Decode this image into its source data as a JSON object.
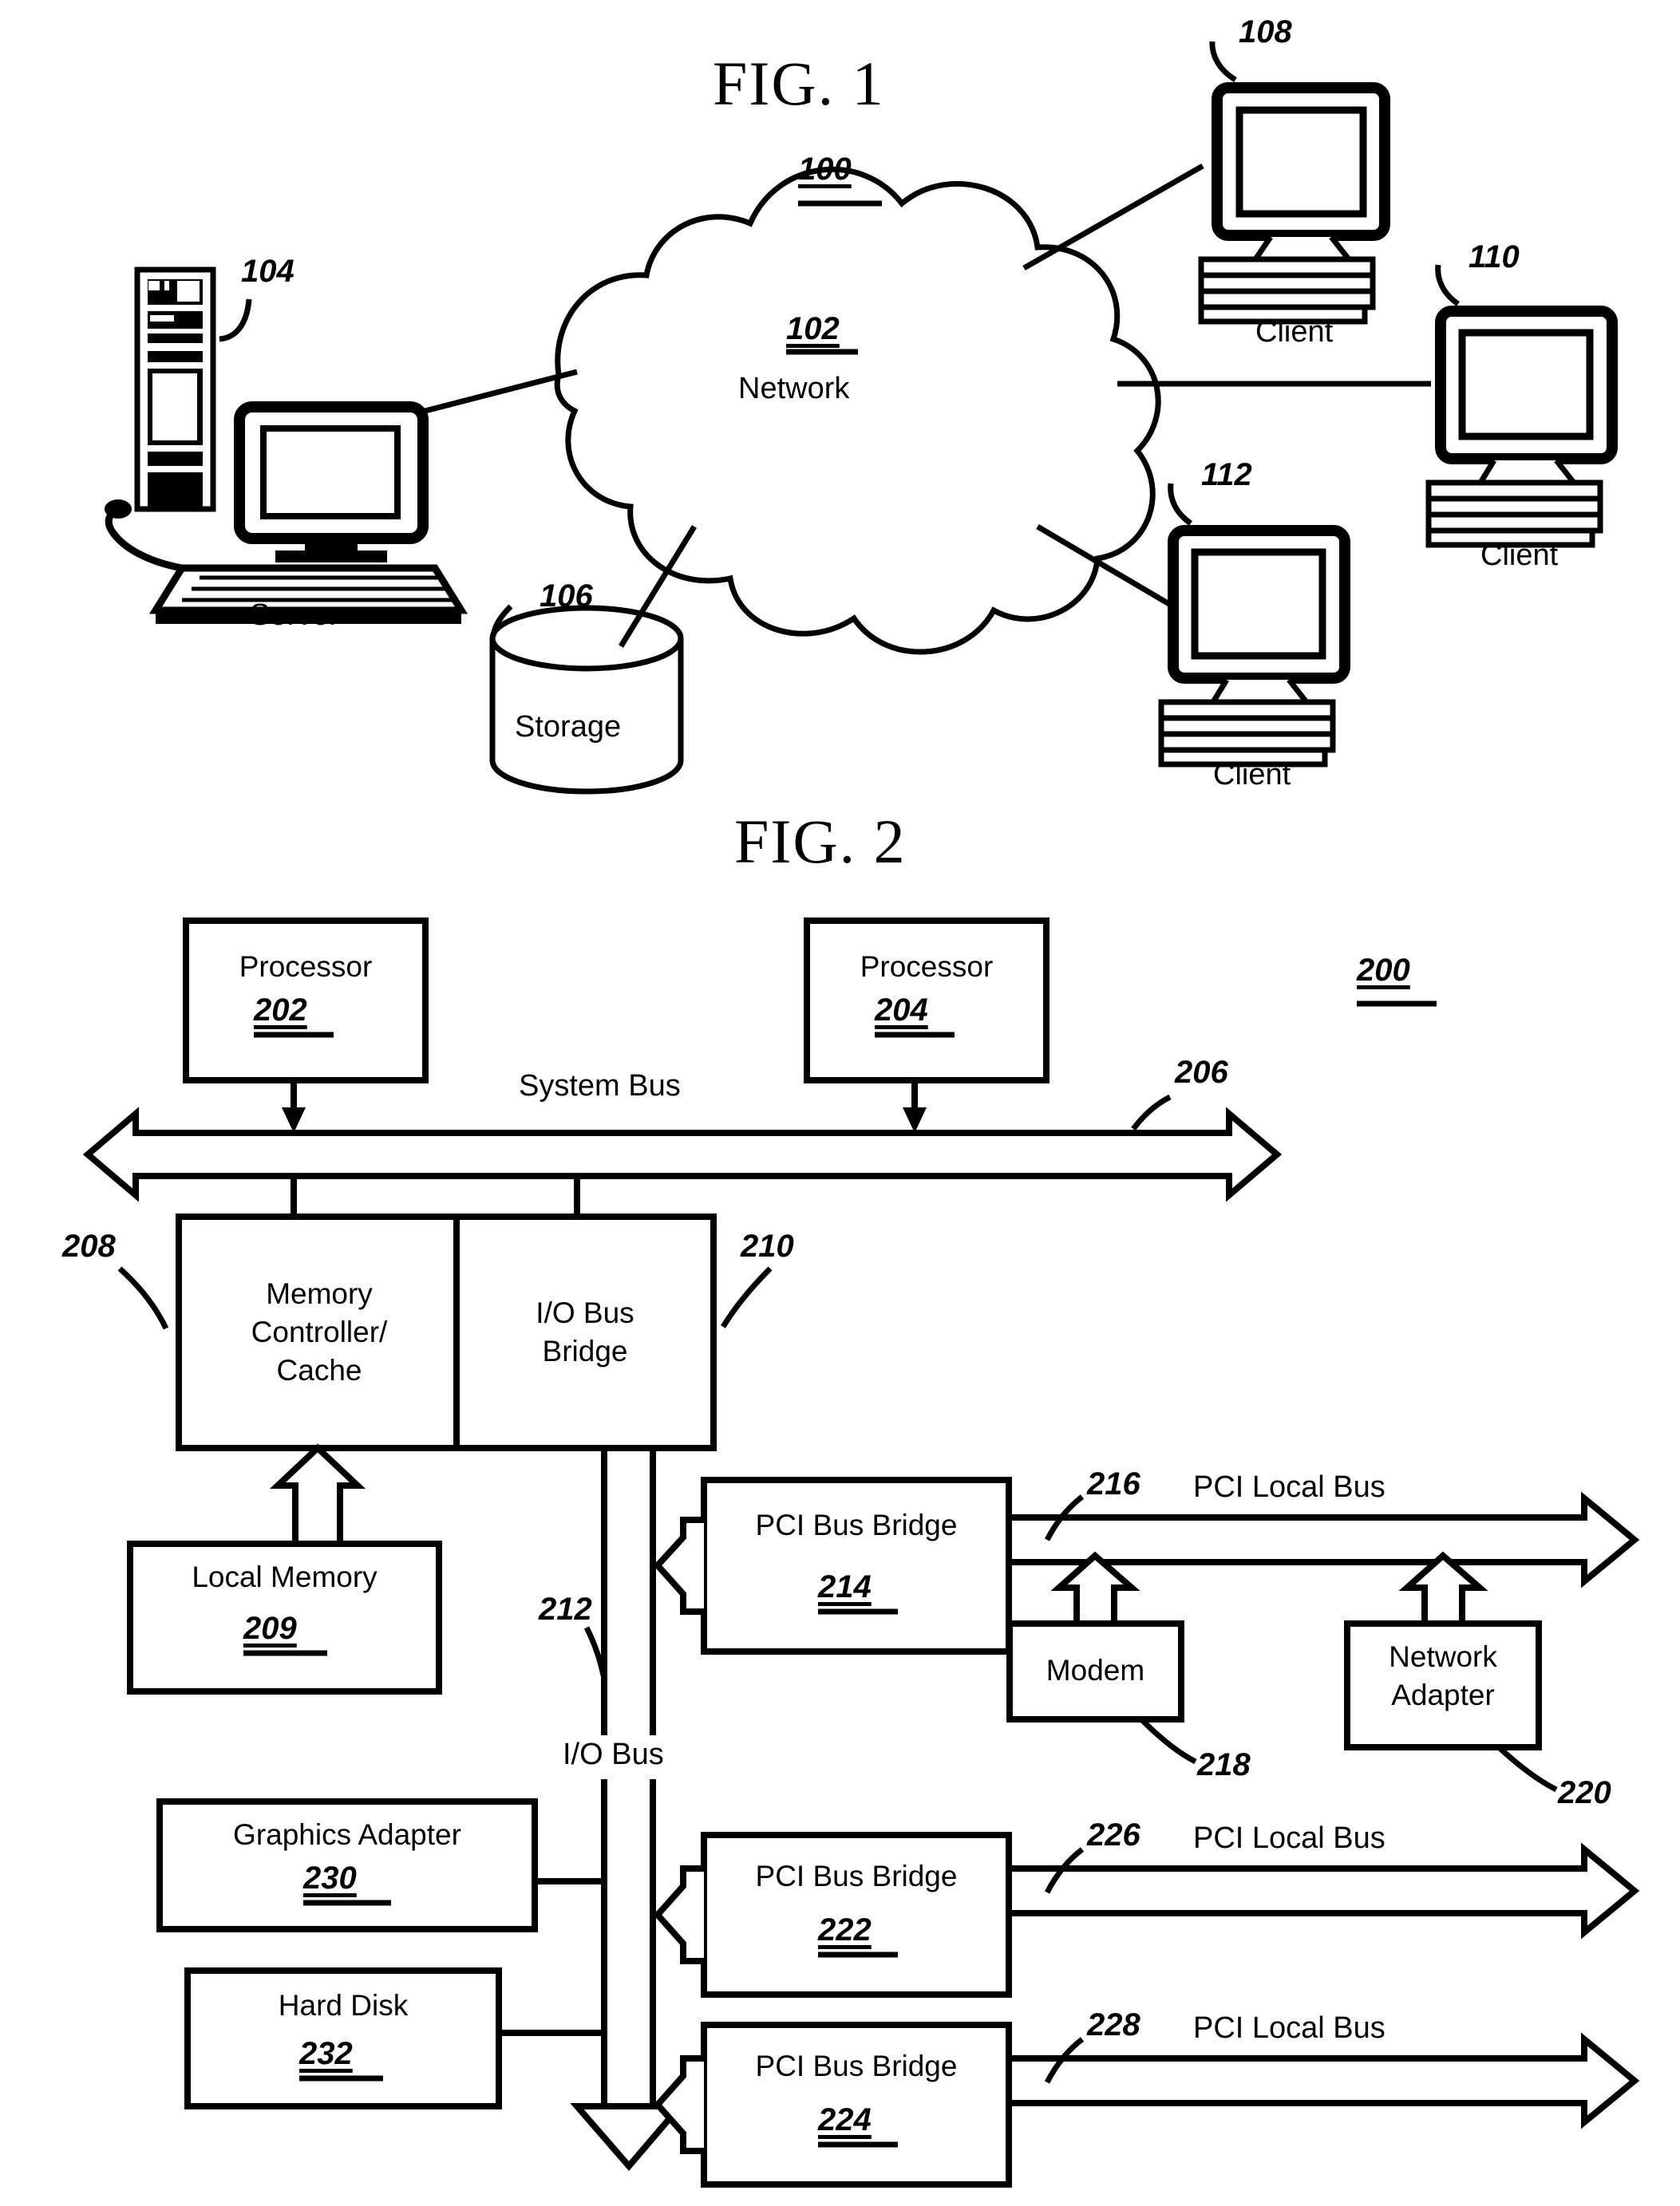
{
  "figure1": {
    "title": "FIG. 1",
    "system_ref": "100",
    "network": {
      "ref": "102",
      "label": "Network"
    },
    "server": {
      "ref": "104",
      "label": "Server"
    },
    "storage": {
      "ref": "106",
      "label": "Storage"
    },
    "clients": [
      {
        "ref": "108",
        "label": "Client"
      },
      {
        "ref": "110",
        "label": "Client"
      },
      {
        "ref": "112",
        "label": "Client"
      }
    ]
  },
  "figure2": {
    "title": "FIG. 2",
    "system_ref": "200",
    "processors": [
      {
        "label": "Processor",
        "ref": "202"
      },
      {
        "label": "Processor",
        "ref": "204"
      }
    ],
    "system_bus": {
      "label": "System Bus",
      "ref": "206"
    },
    "memory_controller": {
      "line1": "Memory",
      "line2": "Controller/",
      "line3": "Cache",
      "ref": "208"
    },
    "io_bus_bridge": {
      "line1": "I/O Bus",
      "line2": "Bridge",
      "ref": "210"
    },
    "local_memory": {
      "label": "Local Memory",
      "ref": "209"
    },
    "io_bus": {
      "label": "I/O Bus",
      "ref": "212"
    },
    "pci_bridges": [
      {
        "label": "PCI Bus Bridge",
        "ref": "214",
        "bus_ref": "216",
        "bus_label": "PCI Local Bus"
      },
      {
        "label": "PCI Bus Bridge",
        "ref": "222",
        "bus_ref": "226",
        "bus_label": "PCI Local Bus"
      },
      {
        "label": "PCI Bus Bridge",
        "ref": "224",
        "bus_ref": "228",
        "bus_label": "PCI Local Bus"
      }
    ],
    "modem": {
      "label": "Modem",
      "ref": "218"
    },
    "network_adapter": {
      "line1": "Network",
      "line2": "Adapter",
      "ref": "220"
    },
    "graphics_adapter": {
      "label": "Graphics Adapter",
      "ref": "230"
    },
    "hard_disk": {
      "label": "Hard Disk",
      "ref": "232"
    }
  },
  "colors": {
    "ink": "#000000",
    "paper": "#ffffff"
  }
}
